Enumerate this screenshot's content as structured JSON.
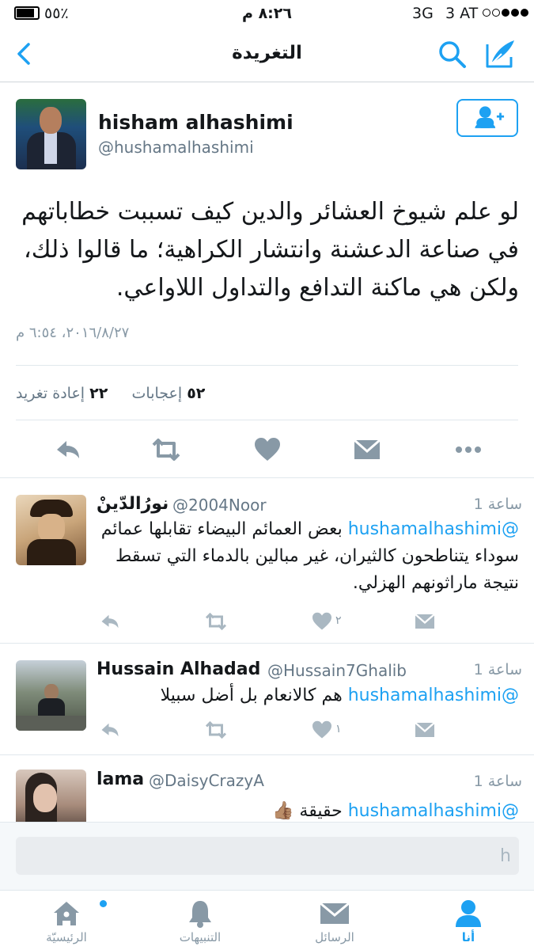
{
  "status_bar": {
    "battery_percent": "٥٥٪",
    "time": "٨:٢٦ م",
    "network": "3G",
    "carrier": "3 AT"
  },
  "nav": {
    "title": "التغريدة"
  },
  "tweet": {
    "author_name": "hisham alhashimi",
    "author_handle": "@hushamalhashimi",
    "text": "لو علم شيوخ العشائر والدين كيف تسببت خطاباتهم في صناعة الدعشنة وانتشار الكراهية؛ ما قالوا ذلك، ولكن هي ماكنة التدافع والتداول اللاواعي.",
    "date": "٢٠١٦/٨/٢٧، ٦:٥٤ م",
    "likes_count": "٥٢",
    "likes_label": "إعجابات",
    "retweets_count": "٢٢",
    "retweets_label": "إعادة تغريد"
  },
  "replies": [
    {
      "name": "نورُالدّينْ",
      "handle": "@2004Noor",
      "time": "1 ساعة",
      "mention": "@hushamalhashimi",
      "text": "بعض العمائم البيضاء تقابلها عمائم سوداء يتناطحون كالثيران، غير مبالين بالدماء التي تسقط نتيجة ماراثونهم الهزلي.",
      "likes": "٢"
    },
    {
      "name": "Hussain Alhadad",
      "handle": "@Hussain7Ghalib",
      "time": "1 ساعة",
      "mention": "@hushamalhashimi",
      "text": "هم كالانعام بل أضل سبيلا",
      "likes": "١"
    },
    {
      "name": "lama",
      "handle": "@DaisyCrazyA",
      "time": "1 ساعة",
      "mention": "@hushamalhashimi",
      "text": "حقيقة 👍🏽"
    }
  ],
  "composer": {
    "value": "h"
  },
  "tabs": [
    {
      "label": "الرئيسيّة",
      "icon": "home-icon"
    },
    {
      "label": "التنبيهات",
      "icon": "bell-icon"
    },
    {
      "label": "الرسائل",
      "icon": "envelope-icon"
    },
    {
      "label": "أنا",
      "icon": "person-icon"
    }
  ],
  "colors": {
    "accent": "#1da1f2",
    "icon_gray": "#aab8c2",
    "text_gray": "#657786"
  }
}
